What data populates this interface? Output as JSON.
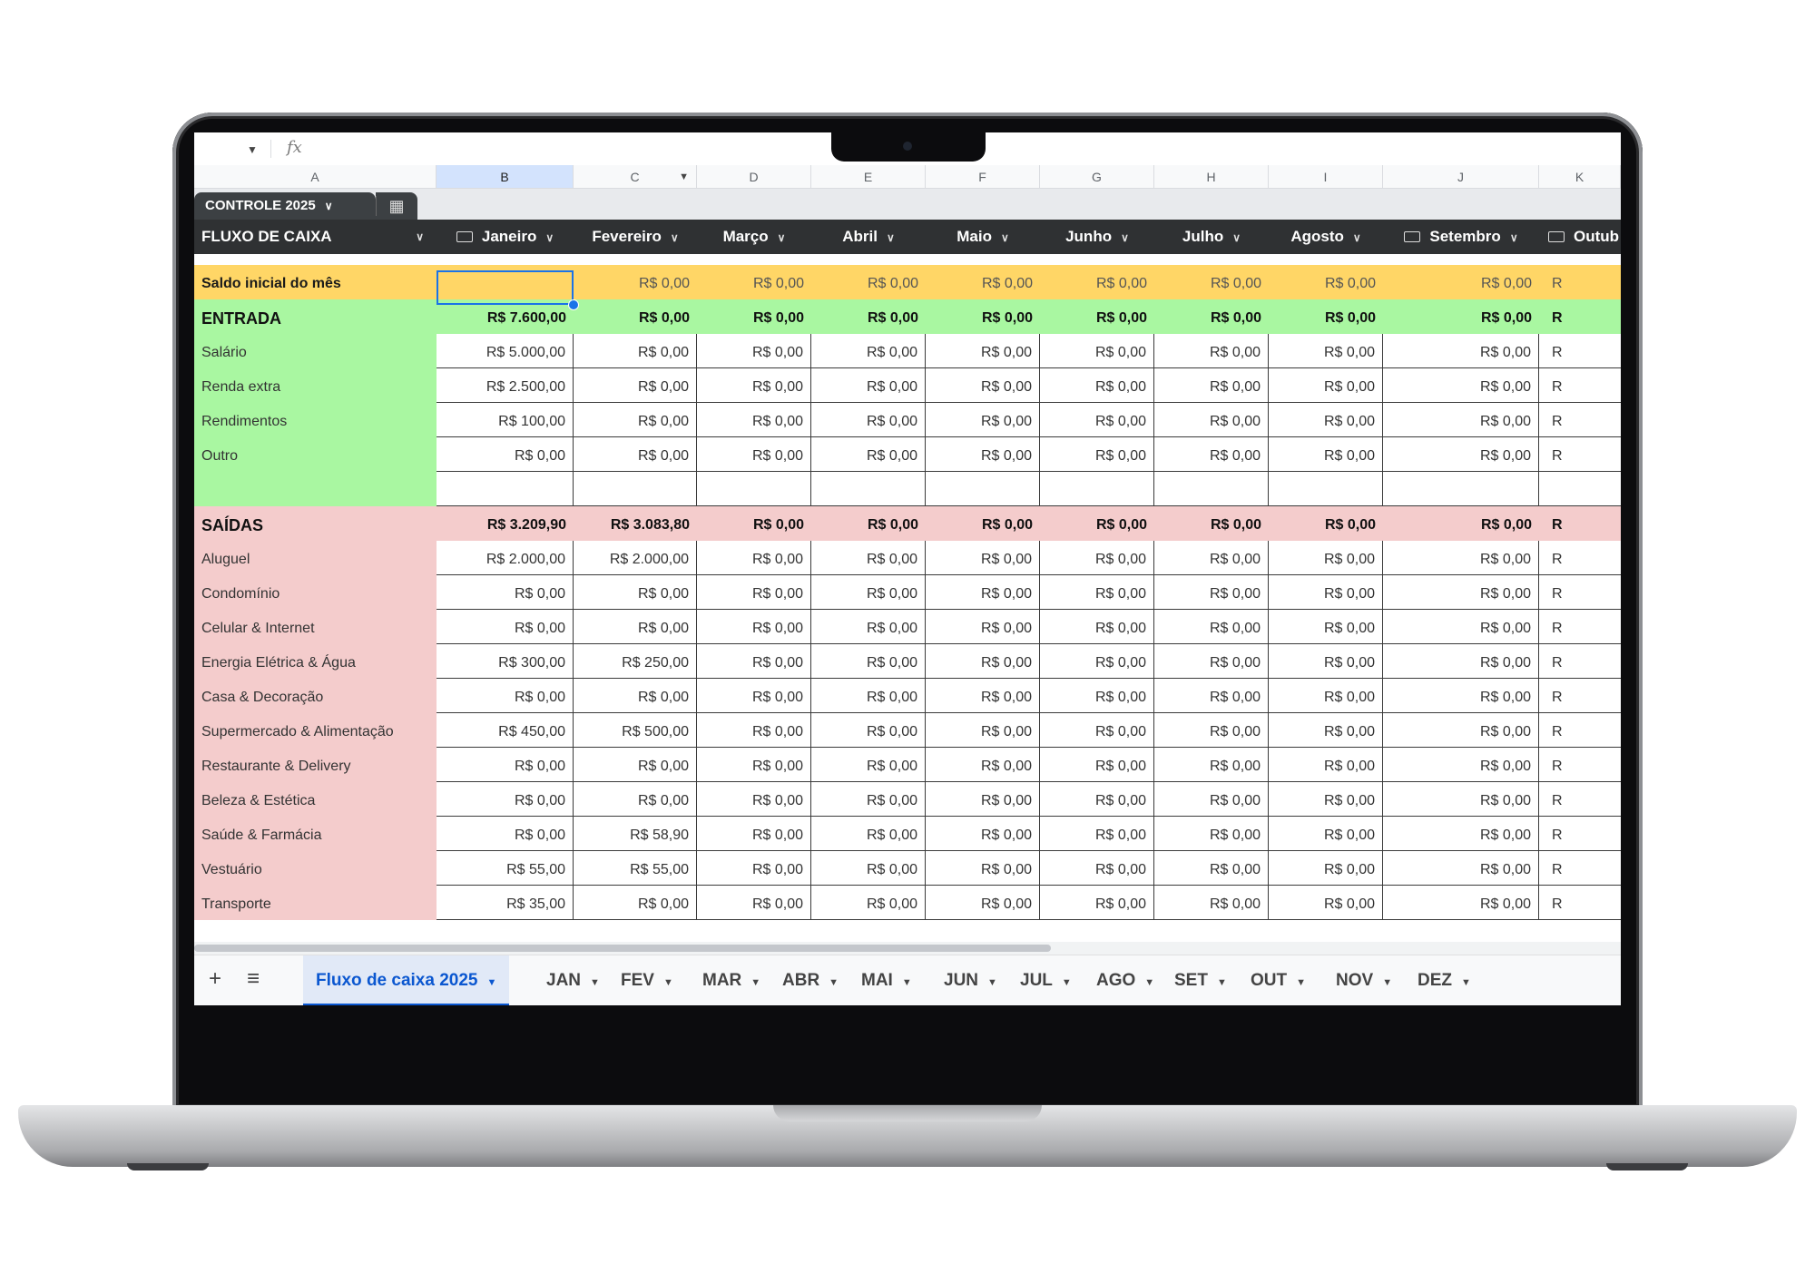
{
  "formula_bar": {
    "fx_label": "fx"
  },
  "columns": [
    "A",
    "B",
    "C",
    "D",
    "E",
    "F",
    "G",
    "H",
    "I",
    "J",
    "K"
  ],
  "controle": {
    "label": "CONTROLE 2025"
  },
  "header": {
    "title": "FLUXO DE CAIXA",
    "months": [
      "Janeiro",
      "Fevereiro",
      "Março",
      "Abril",
      "Maio",
      "Junho",
      "Julho",
      "Agosto",
      "Setembro",
      "Outub"
    ]
  },
  "saldo": {
    "label": "Saldo inicial do mês",
    "values": [
      "",
      "R$ 0,00",
      "R$ 0,00",
      "R$ 0,00",
      "R$ 0,00",
      "R$ 0,00",
      "R$ 0,00",
      "R$ 0,00",
      "R$ 0,00",
      "R"
    ]
  },
  "entrada": {
    "label": "ENTRADA",
    "totals": [
      "R$ 7.600,00",
      "R$ 0,00",
      "R$ 0,00",
      "R$ 0,00",
      "R$ 0,00",
      "R$ 0,00",
      "R$ 0,00",
      "R$ 0,00",
      "R$ 0,00",
      "R"
    ],
    "rows": [
      {
        "label": "Salário",
        "values": [
          "R$ 5.000,00",
          "R$ 0,00",
          "R$ 0,00",
          "R$ 0,00",
          "R$ 0,00",
          "R$ 0,00",
          "R$ 0,00",
          "R$ 0,00",
          "R$ 0,00",
          "R"
        ]
      },
      {
        "label": "Renda extra",
        "values": [
          "R$ 2.500,00",
          "R$ 0,00",
          "R$ 0,00",
          "R$ 0,00",
          "R$ 0,00",
          "R$ 0,00",
          "R$ 0,00",
          "R$ 0,00",
          "R$ 0,00",
          "R"
        ]
      },
      {
        "label": "Rendimentos",
        "values": [
          "R$ 100,00",
          "R$ 0,00",
          "R$ 0,00",
          "R$ 0,00",
          "R$ 0,00",
          "R$ 0,00",
          "R$ 0,00",
          "R$ 0,00",
          "R$ 0,00",
          "R"
        ]
      },
      {
        "label": "Outro",
        "values": [
          "R$ 0,00",
          "R$ 0,00",
          "R$ 0,00",
          "R$ 0,00",
          "R$ 0,00",
          "R$ 0,00",
          "R$ 0,00",
          "R$ 0,00",
          "R$ 0,00",
          "R"
        ]
      }
    ]
  },
  "saidas": {
    "label": "SAÍDAS",
    "totals": [
      "R$ 3.209,90",
      "R$ 3.083,80",
      "R$ 0,00",
      "R$ 0,00",
      "R$ 0,00",
      "R$ 0,00",
      "R$ 0,00",
      "R$ 0,00",
      "R$ 0,00",
      "R"
    ],
    "rows": [
      {
        "label": "Aluguel",
        "values": [
          "R$ 2.000,00",
          "R$ 2.000,00",
          "R$ 0,00",
          "R$ 0,00",
          "R$ 0,00",
          "R$ 0,00",
          "R$ 0,00",
          "R$ 0,00",
          "R$ 0,00",
          "R"
        ]
      },
      {
        "label": "Condomínio",
        "values": [
          "R$ 0,00",
          "R$ 0,00",
          "R$ 0,00",
          "R$ 0,00",
          "R$ 0,00",
          "R$ 0,00",
          "R$ 0,00",
          "R$ 0,00",
          "R$ 0,00",
          "R"
        ]
      },
      {
        "label": "Celular & Internet",
        "values": [
          "R$ 0,00",
          "R$ 0,00",
          "R$ 0,00",
          "R$ 0,00",
          "R$ 0,00",
          "R$ 0,00",
          "R$ 0,00",
          "R$ 0,00",
          "R$ 0,00",
          "R"
        ]
      },
      {
        "label": "Energia Elétrica & Água",
        "values": [
          "R$ 300,00",
          "R$ 250,00",
          "R$ 0,00",
          "R$ 0,00",
          "R$ 0,00",
          "R$ 0,00",
          "R$ 0,00",
          "R$ 0,00",
          "R$ 0,00",
          "R"
        ]
      },
      {
        "label": "Casa & Decoração",
        "values": [
          "R$ 0,00",
          "R$ 0,00",
          "R$ 0,00",
          "R$ 0,00",
          "R$ 0,00",
          "R$ 0,00",
          "R$ 0,00",
          "R$ 0,00",
          "R$ 0,00",
          "R"
        ]
      },
      {
        "label": "Supermercado & Alimentação",
        "values": [
          "R$ 450,00",
          "R$ 500,00",
          "R$ 0,00",
          "R$ 0,00",
          "R$ 0,00",
          "R$ 0,00",
          "R$ 0,00",
          "R$ 0,00",
          "R$ 0,00",
          "R"
        ]
      },
      {
        "label": "Restaurante & Delivery",
        "values": [
          "R$ 0,00",
          "R$ 0,00",
          "R$ 0,00",
          "R$ 0,00",
          "R$ 0,00",
          "R$ 0,00",
          "R$ 0,00",
          "R$ 0,00",
          "R$ 0,00",
          "R"
        ]
      },
      {
        "label": "Beleza & Estética",
        "values": [
          "R$ 0,00",
          "R$ 0,00",
          "R$ 0,00",
          "R$ 0,00",
          "R$ 0,00",
          "R$ 0,00",
          "R$ 0,00",
          "R$ 0,00",
          "R$ 0,00",
          "R"
        ]
      },
      {
        "label": "Saúde & Farmácia",
        "values": [
          "R$ 0,00",
          "R$ 58,90",
          "R$ 0,00",
          "R$ 0,00",
          "R$ 0,00",
          "R$ 0,00",
          "R$ 0,00",
          "R$ 0,00",
          "R$ 0,00",
          "R"
        ]
      },
      {
        "label": "Vestuário",
        "values": [
          "R$ 55,00",
          "R$ 55,00",
          "R$ 0,00",
          "R$ 0,00",
          "R$ 0,00",
          "R$ 0,00",
          "R$ 0,00",
          "R$ 0,00",
          "R$ 0,00",
          "R"
        ]
      },
      {
        "label": "Transporte",
        "values": [
          "R$ 35,00",
          "R$ 0,00",
          "R$ 0,00",
          "R$ 0,00",
          "R$ 0,00",
          "R$ 0,00",
          "R$ 0,00",
          "R$ 0,00",
          "R$ 0,00",
          "R"
        ]
      }
    ]
  },
  "tabs": {
    "add_label": "+",
    "menu_label": "≡",
    "items": [
      "Fluxo de caixa 2025",
      "JAN",
      "FEV",
      "MAR",
      "ABR",
      "MAI",
      "JUN",
      "JUL",
      "AGO",
      "SET",
      "OUT",
      "NOV",
      "DEZ"
    ],
    "active": "Fluxo de caixa 2025"
  },
  "colors": {
    "saldo_bg": "#ffd666",
    "entrada_bg": "#a9f7a1",
    "saidas_bg": "#f4cccc",
    "header_bg": "#2f3133",
    "active_tab": "#0b57d0"
  }
}
